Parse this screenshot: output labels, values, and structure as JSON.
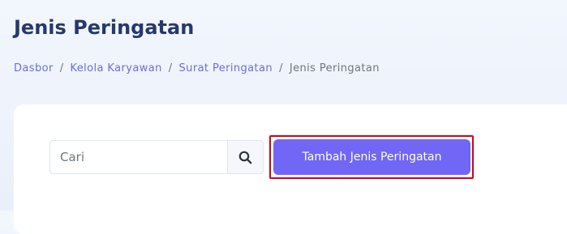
{
  "header": {
    "title": "Jenis Peringatan"
  },
  "breadcrumb": {
    "items": [
      {
        "label": "Dasbor"
      },
      {
        "label": "Kelola Karyawan"
      },
      {
        "label": "Surat Peringatan"
      }
    ],
    "separator": "/",
    "current": "Jenis Peringatan"
  },
  "search": {
    "value": "",
    "placeholder": "Cari",
    "icon": "search-icon"
  },
  "actions": {
    "add_label": "Tambah Jenis Peringatan",
    "add_color": "#7166f5",
    "highlight_color": "#d0021b"
  },
  "colors": {
    "title": "#25396f",
    "link": "#6a6fd6",
    "muted": "#6c757d"
  }
}
